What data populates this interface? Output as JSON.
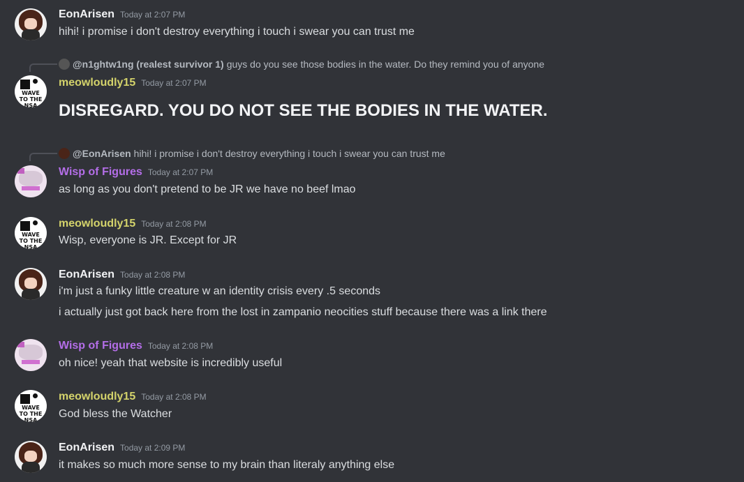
{
  "messages": [
    {
      "author": "EonArisen",
      "time": "Today at 2:07 PM",
      "lines": [
        "hihi! i promise i don't destroy everything i touch i swear you can trust me"
      ]
    },
    {
      "reply": {
        "name": "@n1ghtw1ng (realest survivor 1)",
        "text": "guys do you see those bodies in the water. Do they remind you of anyone"
      },
      "author": "meowloudly15",
      "time": "Today at 2:07 PM",
      "lines": [
        "DISREGARD. YOU DO NOT SEE THE BODIES IN THE WATER."
      ]
    },
    {
      "reply": {
        "name": "@EonArisen",
        "text": "hihi! i promise i don't destroy everything i touch i swear you can trust me"
      },
      "author": "Wisp of Figures",
      "time": "Today at 2:07 PM",
      "lines": [
        "as long as you don't pretend to be JR we have no beef lmao"
      ]
    },
    {
      "author": "meowloudly15",
      "time": "Today at 2:08 PM",
      "lines": [
        "Wisp, everyone is JR. Except for JR"
      ]
    },
    {
      "author": "EonArisen",
      "time": "Today at 2:08 PM",
      "lines": [
        "i'm just a funky little creature w an identity crisis every .5 seconds",
        "i actually just got back here from the lost in zampanio neocities stuff because there was a link there"
      ]
    },
    {
      "author": "Wisp of Figures",
      "time": "Today at 2:08 PM",
      "lines": [
        "oh nice! yeah that website is incredibly useful"
      ]
    },
    {
      "author": "meowloudly15",
      "time": "Today at 2:08 PM",
      "lines": [
        "God bless the Watcher"
      ]
    },
    {
      "author": "EonArisen",
      "time": "Today at 2:09 PM",
      "lines": [
        "it makes so much more sense to my brain than literaly anything else"
      ]
    }
  ],
  "avatar_text": {
    "nsa": "WAVE TO THE NSA"
  },
  "colors": {
    "background": "#313338",
    "eon": "#f2f3f5",
    "meow": "#d4d36b",
    "wisp": "#b46ee8",
    "timestamp": "#949ba4"
  }
}
